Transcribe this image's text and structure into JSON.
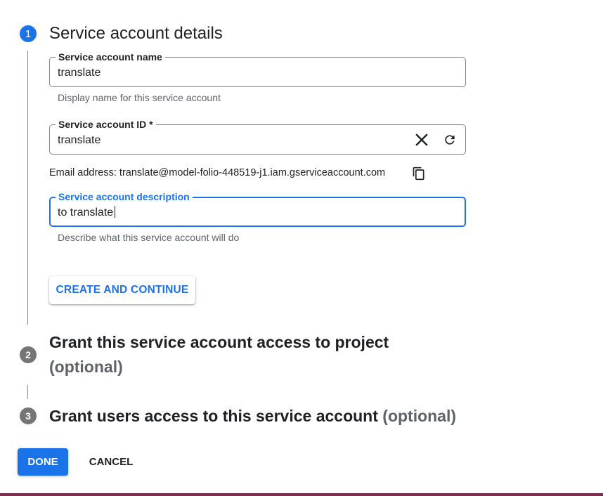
{
  "steps": [
    {
      "number": "1",
      "title": "Service account details"
    },
    {
      "number": "2",
      "title_line1": "Grant this service account access to project",
      "optional": "(optional)"
    },
    {
      "number": "3",
      "title": "Grant users access to this service account",
      "optional": "(optional)"
    }
  ],
  "fields": {
    "name": {
      "label": "Service account name",
      "value": "translate",
      "hint": "Display name for this service account"
    },
    "id": {
      "label": "Service account ID *",
      "value": "translate"
    },
    "description": {
      "label": "Service account description",
      "value": "to translate",
      "hint": "Describe what this service account will do"
    }
  },
  "email": {
    "text": "Email address: translate@model-folio-448519-j1.iam.gserviceaccount.com"
  },
  "buttons": {
    "create_continue": "CREATE AND CONTINUE",
    "done": "DONE",
    "cancel": "CANCEL"
  },
  "icons": {
    "clear": "close-icon",
    "refresh": "refresh-icon",
    "copy": "copy-icon"
  },
  "colors": {
    "primary": "#1a73e8",
    "step_inactive": "#757575",
    "bottom_bar": "#7b2d4f"
  }
}
